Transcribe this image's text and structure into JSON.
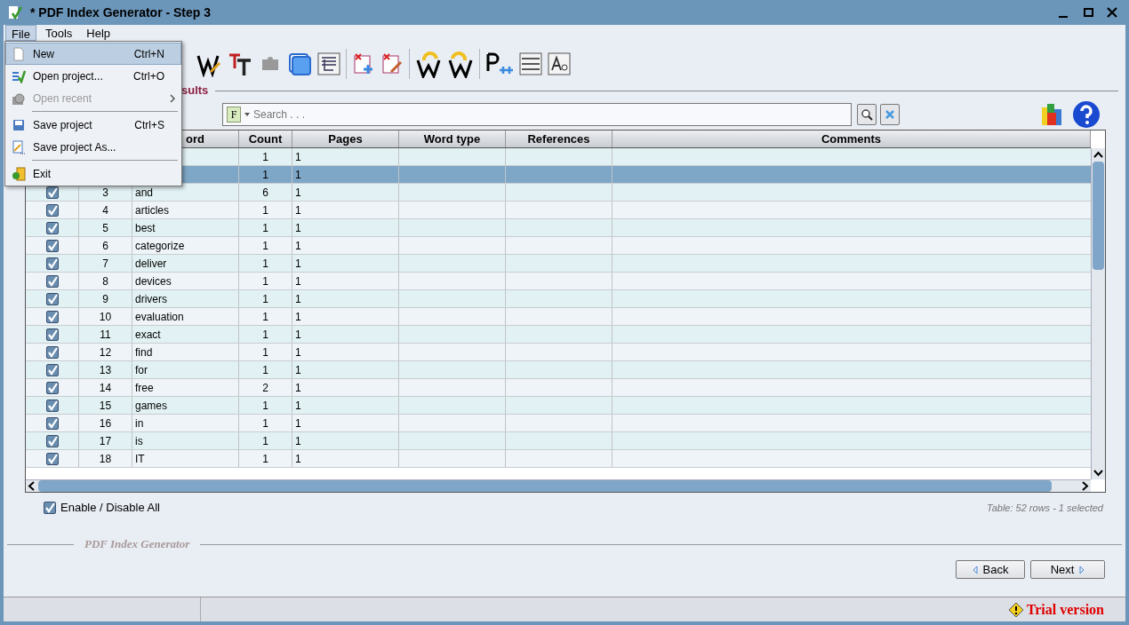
{
  "window": {
    "title": "* PDF Index Generator - Step 3"
  },
  "menu_bar": [
    {
      "label": "File",
      "selected": true
    },
    {
      "label": "Tools",
      "selected": false
    },
    {
      "label": "Help",
      "selected": false
    }
  ],
  "file_menu": [
    {
      "kind": "item",
      "label": "New",
      "shortcut": "Ctrl+N",
      "disabled": false,
      "selected": true
    },
    {
      "kind": "item",
      "label": "Open project...",
      "shortcut": "Ctrl+O",
      "disabled": false,
      "selected": false
    },
    {
      "kind": "submenu",
      "label": "Open recent",
      "disabled": true,
      "selected": false
    },
    {
      "kind": "separator"
    },
    {
      "kind": "item",
      "label": "Save project",
      "shortcut": "Ctrl+S",
      "disabled": false,
      "selected": false
    },
    {
      "kind": "item",
      "label": "Save project As...",
      "disabled": false,
      "selected": false
    },
    {
      "kind": "separator"
    },
    {
      "kind": "item",
      "label": "Exit",
      "disabled": false,
      "selected": false
    }
  ],
  "section_title": "sults",
  "search": {
    "filter_label": "F",
    "placeholder": "Search . . ."
  },
  "table": {
    "columns": [
      "",
      "",
      "ord",
      "Count",
      "Pages",
      "Word type",
      "References",
      "Comments"
    ],
    "rows": [
      {
        "count": "1",
        "pages": "1",
        "selected": false
      },
      {
        "count": "1",
        "pages": "1",
        "selected": true
      },
      {
        "checked": true,
        "number": "3",
        "word": "and",
        "count": "6",
        "pages": "1",
        "selected": false
      },
      {
        "checked": true,
        "number": "4",
        "word": "articles",
        "count": "1",
        "pages": "1",
        "selected": false
      },
      {
        "checked": true,
        "number": "5",
        "word": "best",
        "count": "1",
        "pages": "1",
        "selected": false
      },
      {
        "checked": true,
        "number": "6",
        "word": "categorize",
        "count": "1",
        "pages": "1",
        "selected": false
      },
      {
        "checked": true,
        "number": "7",
        "word": "deliver",
        "count": "1",
        "pages": "1",
        "selected": false
      },
      {
        "checked": true,
        "number": "8",
        "word": "devices",
        "count": "1",
        "pages": "1",
        "selected": false
      },
      {
        "checked": true,
        "number": "9",
        "word": "drivers",
        "count": "1",
        "pages": "1",
        "selected": false
      },
      {
        "checked": true,
        "number": "10",
        "word": "evaluation",
        "count": "1",
        "pages": "1",
        "selected": false
      },
      {
        "checked": true,
        "number": "11",
        "word": "exact",
        "count": "1",
        "pages": "1",
        "selected": false
      },
      {
        "checked": true,
        "number": "12",
        "word": "find",
        "count": "1",
        "pages": "1",
        "selected": false
      },
      {
        "checked": true,
        "number": "13",
        "word": "for",
        "count": "1",
        "pages": "1",
        "selected": false
      },
      {
        "checked": true,
        "number": "14",
        "word": "free",
        "count": "2",
        "pages": "1",
        "selected": false
      },
      {
        "checked": true,
        "number": "15",
        "word": "games",
        "count": "1",
        "pages": "1",
        "selected": false
      },
      {
        "checked": true,
        "number": "16",
        "word": "in",
        "count": "1",
        "pages": "1",
        "selected": false
      },
      {
        "checked": true,
        "number": "17",
        "word": "is",
        "count": "1",
        "pages": "1",
        "selected": false
      },
      {
        "checked": true,
        "number": "18",
        "word": "IT",
        "count": "1",
        "pages": "1",
        "selected": false
      }
    ]
  },
  "enable_all": {
    "label": "Enable / Disable All",
    "checked": true
  },
  "table_status": "Table: 52 rows - 1 selected",
  "footer_title": "PDF Index Generator",
  "buttons": [
    "Back",
    "Next"
  ],
  "status_bar": {
    "trial": "Trial version"
  }
}
